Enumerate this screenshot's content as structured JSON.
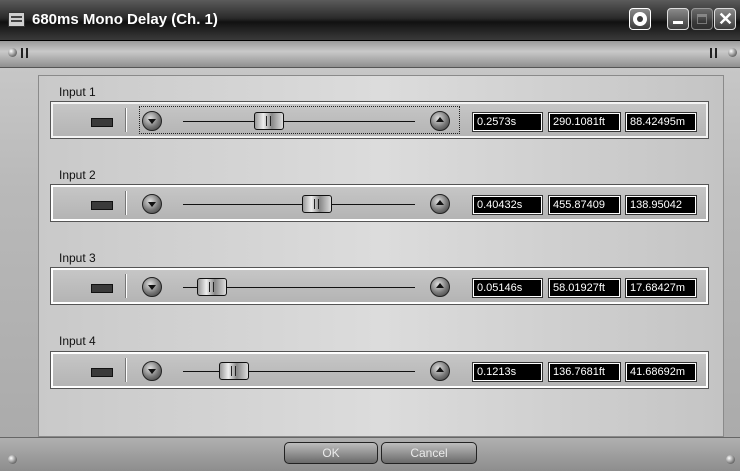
{
  "window": {
    "title": "680ms Mono Delay (Ch. 1)",
    "icons": [
      "app-icon",
      "recycle-icon",
      "minimize-icon",
      "maximize-icon",
      "close-icon"
    ]
  },
  "inputs": [
    {
      "label": "Input 1",
      "seconds": "0.2573s",
      "feet": "290.1081ft",
      "meters": "88.42495m",
      "slider_fraction": 0.35,
      "focused": true
    },
    {
      "label": "Input 2",
      "seconds": "0.40432s",
      "feet": "455.87409",
      "meters": "138.95042",
      "slider_fraction": 0.59,
      "focused": false
    },
    {
      "label": "Input 3",
      "seconds": "0.05146s",
      "feet": "58.01927ft",
      "meters": "17.68427m",
      "slider_fraction": 0.07,
      "focused": false
    },
    {
      "label": "Input 4",
      "seconds": "0.1213s",
      "feet": "136.7681ft",
      "meters": "41.68692m",
      "slider_fraction": 0.18,
      "focused": false
    }
  ],
  "buttons": {
    "ok": "OK",
    "cancel": "Cancel"
  }
}
